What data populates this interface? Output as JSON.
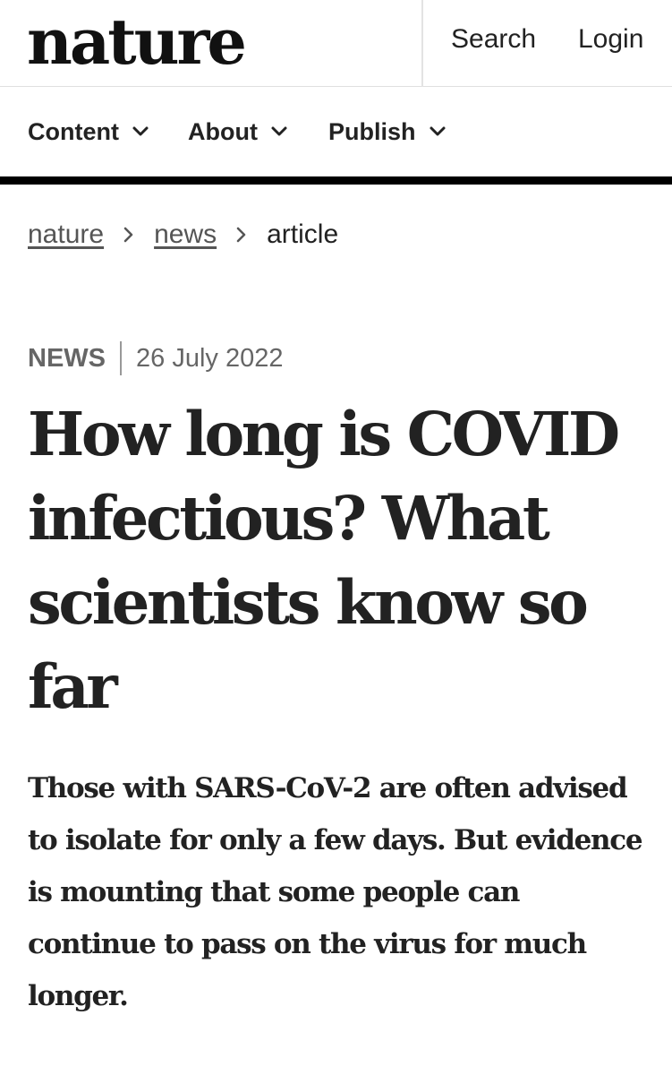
{
  "header": {
    "logo_text": "nature",
    "search_label": "Search",
    "login_label": "Login"
  },
  "nav": {
    "items": [
      {
        "label": "Content",
        "icon": "chevron-down-icon"
      },
      {
        "label": "About",
        "icon": "chevron-down-icon"
      },
      {
        "label": "Publish",
        "icon": "chevron-down-icon"
      }
    ]
  },
  "breadcrumb": {
    "items": [
      {
        "label": "nature",
        "link": true
      },
      {
        "label": "news",
        "link": true
      },
      {
        "label": "article",
        "link": false
      }
    ],
    "separator_icon": "chevron-right-icon"
  },
  "article": {
    "type": "NEWS",
    "date": "26 July 2022",
    "title": "How long is COVID infectious? What scientists know so far",
    "standfirst": "Those with SARS-CoV-2 are often advised to isolate for only a few days. But evidence is mounting that some people can continue to pass on the virus for much longer."
  },
  "colors": {
    "text": "#222222",
    "muted": "#666666",
    "rule": "#000000",
    "divider": "#e0e0e0",
    "background": "#ffffff"
  }
}
